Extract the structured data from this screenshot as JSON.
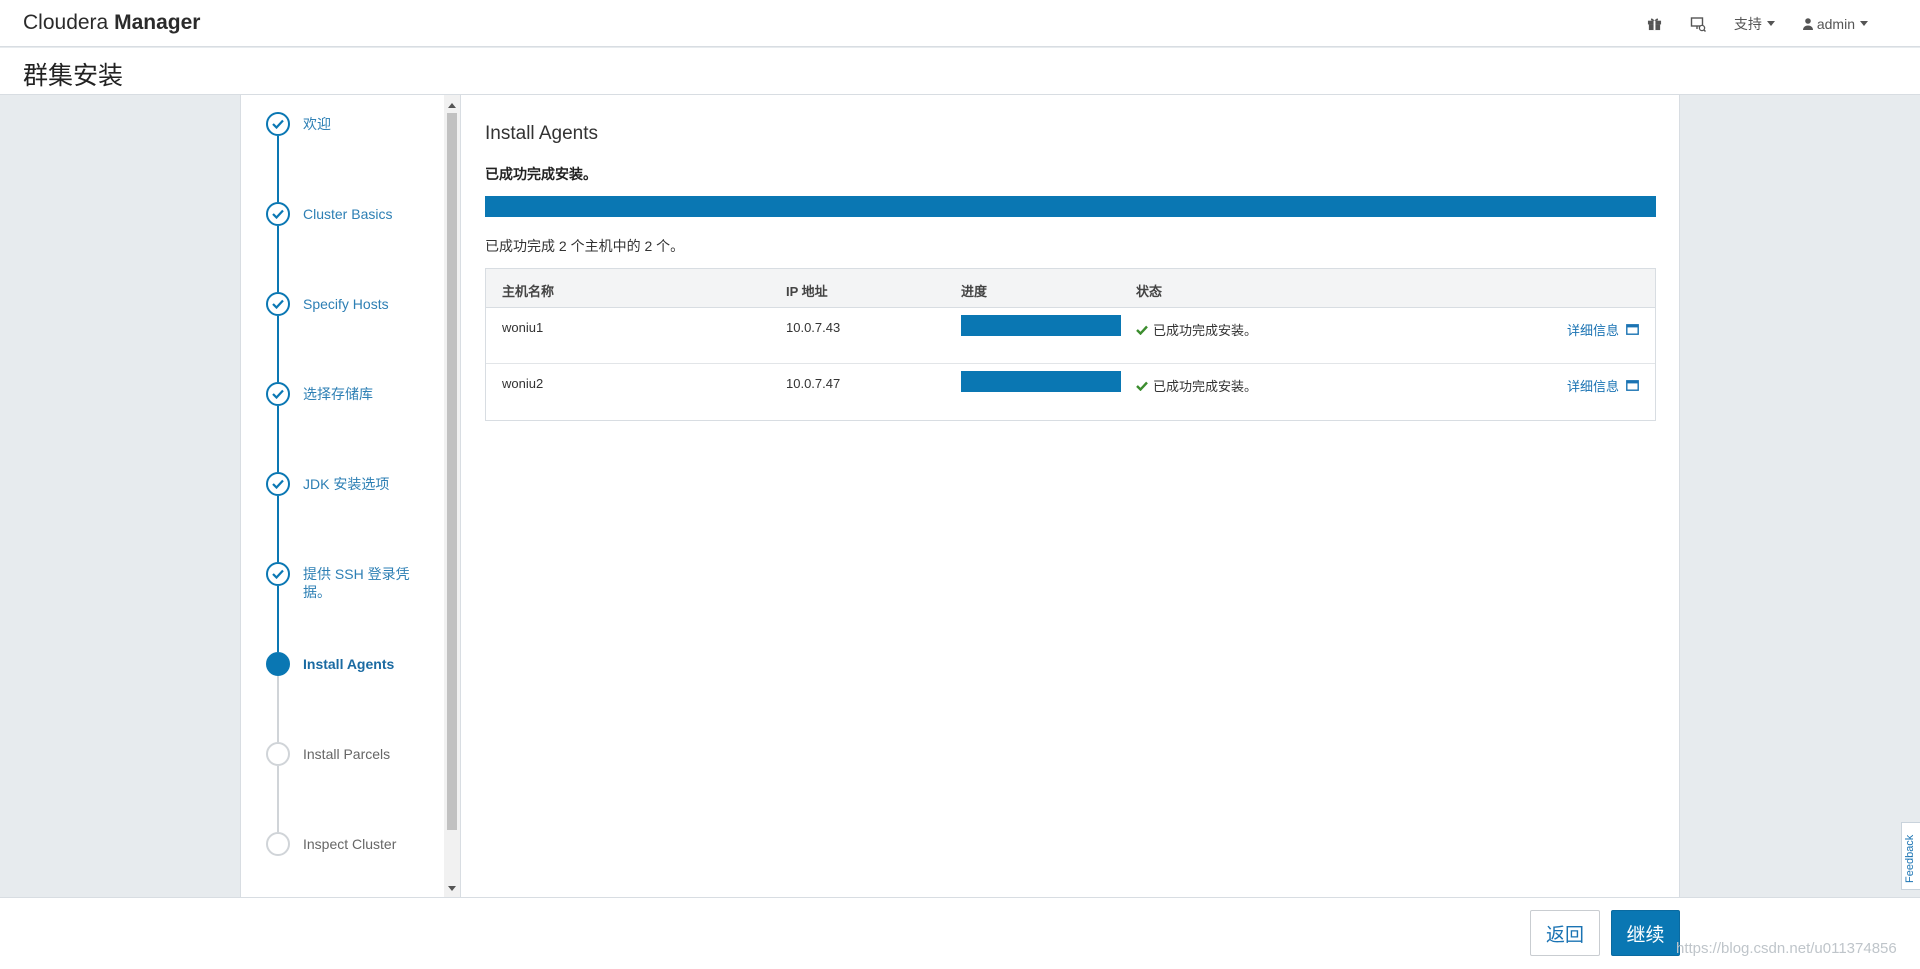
{
  "navbar": {
    "brand_light": "Cloudera",
    "brand_bold": "Manager",
    "icons": [
      "gift-icon",
      "announcement-icon"
    ],
    "support_label": "支持",
    "user_label": "admin"
  },
  "page": {
    "title": "群集安装"
  },
  "steps": [
    {
      "label": "欢迎",
      "state": "done"
    },
    {
      "label": "Cluster Basics",
      "state": "done"
    },
    {
      "label": "Specify Hosts",
      "state": "done"
    },
    {
      "label": "选择存储库",
      "state": "done"
    },
    {
      "label": "JDK 安装选项",
      "state": "done"
    },
    {
      "label": "提供 SSH 登录凭据。",
      "state": "done"
    },
    {
      "label": "Install Agents",
      "state": "current"
    },
    {
      "label": "Install Parcels",
      "state": "todo"
    },
    {
      "label": "Inspect Cluster",
      "state": "todo"
    }
  ],
  "content": {
    "section_title": "Install Agents",
    "success_message": "已成功完成安装。",
    "overall_progress": 1.0,
    "summary": "已成功完成 2 个主机中的 2 个。",
    "table": {
      "headers": [
        "主机名称",
        "IP 地址",
        "进度",
        "状态"
      ],
      "rows": [
        {
          "host": "woniu1",
          "ip": "10.0.7.43",
          "progress": 1.0,
          "status": "已成功完成安装。",
          "detail": "详细信息"
        },
        {
          "host": "woniu2",
          "ip": "10.0.7.47",
          "progress": 1.0,
          "status": "已成功完成安装。",
          "detail": "详细信息"
        }
      ]
    }
  },
  "footer": {
    "back_label": "返回",
    "continue_label": "继续",
    "watermark": "https://blog.csdn.net/u011374856"
  },
  "feedback_label": "Feedback",
  "colors": {
    "accent": "#0a77b3",
    "success": "#3c8d2f",
    "background": "#e7ebee"
  }
}
